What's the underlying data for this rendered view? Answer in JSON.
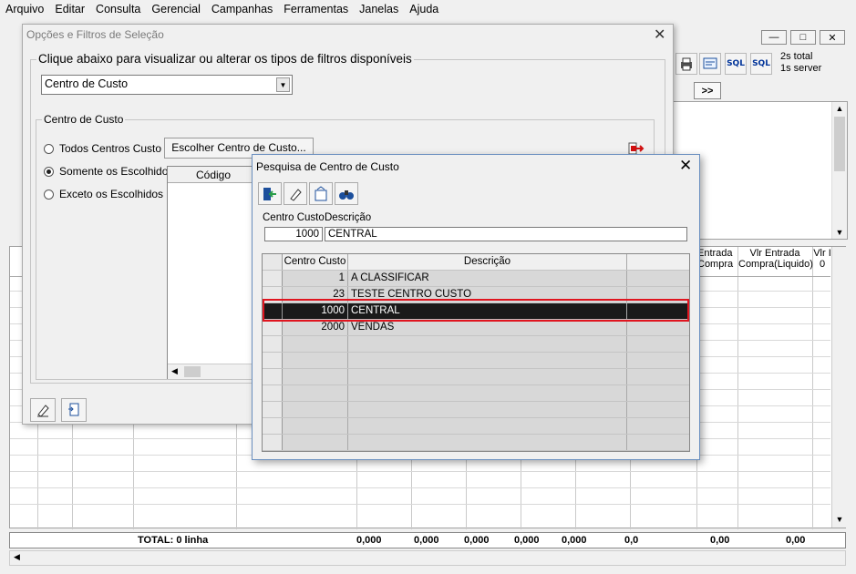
{
  "menubar": [
    "Arquivo",
    "Editar",
    "Consulta",
    "Gerencial",
    "Campanhas",
    "Ferramentas",
    "Janelas",
    "Ajuda"
  ],
  "main_window": {
    "timing_line1": "2s  total",
    "timing_line2": "1s  server",
    "toolbar_icons": [
      "print-icon",
      "form-icon",
      "sql-icon",
      "sql-icon"
    ],
    "sql_label": "SQL",
    "nav_next": ">>",
    "grid_headers": {
      "entrada_compra": "Entrada Compra",
      "vlr_entrada_liquido": "Vlr Entrada Compra(Liquido)",
      "vlr": "Vlr I 0"
    },
    "total_label": "TOTAL: 0 linha",
    "totals": [
      "0,000",
      "0,000",
      "0,000",
      "0,000",
      "0,000",
      "0,0",
      "0,00",
      "0,00"
    ]
  },
  "options_dialog": {
    "title": "Opções e Filtros de Seleção",
    "filter_group_label": "Clique abaixo para visualizar ou alterar os tipos de filtros disponíveis",
    "filter_selected": "Centro de Custo",
    "cc_group_label": "Centro de Custo",
    "radios": [
      {
        "label": "Todos Centros Custo",
        "checked": false
      },
      {
        "label": "Somente os Escolhidos",
        "checked": true
      },
      {
        "label": "Exceto os Escolhidos",
        "checked": false
      }
    ],
    "choose_button": "Escolher Centro de Custo...",
    "grid_header": "Código"
  },
  "search_dialog": {
    "title": "Pesquisa de Centro de Custo",
    "label_cc": "Centro Custo",
    "label_desc": "Descrição",
    "input_cc": "1000",
    "input_desc": "CENTRAL",
    "col_cc": "Centro Custo",
    "col_desc": "Descrição",
    "rows": [
      {
        "cc": "1",
        "desc": "A CLASSIFICAR",
        "selected": false
      },
      {
        "cc": "23",
        "desc": "TESTE CENTRO CUSTO",
        "selected": false
      },
      {
        "cc": "1000",
        "desc": "CENTRAL",
        "selected": true
      },
      {
        "cc": "2000",
        "desc": "VENDAS",
        "selected": false
      }
    ]
  }
}
